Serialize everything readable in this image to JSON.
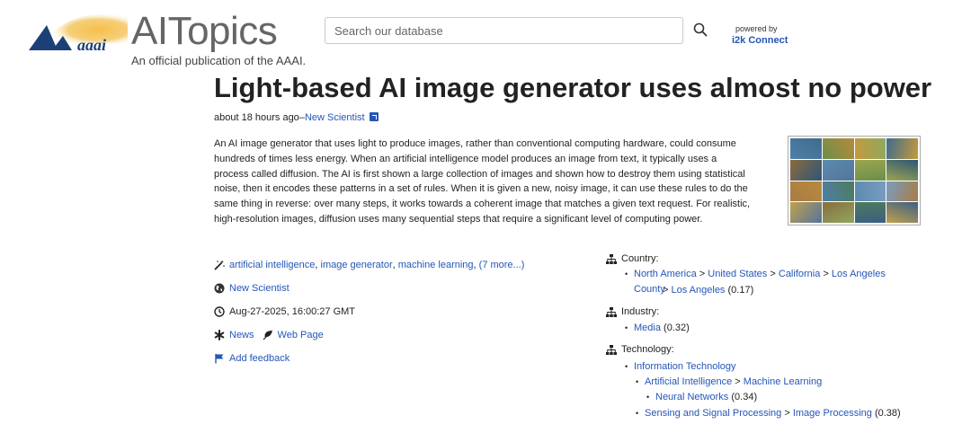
{
  "header": {
    "logo_text": "aaai",
    "brand": "AITopics",
    "tagline": "An official publication of the AAAI.",
    "search_placeholder": "Search our database",
    "powered_by": "powered by",
    "powered_brand_i2k": "i2k",
    "powered_brand_connect": " Connect"
  },
  "article": {
    "title": "Light-based AI image generator uses almost no power",
    "time_ago": "about 18 hours ago",
    "dash": "–",
    "source_link": "New Scientist",
    "summary": "An AI image generator that uses light to produce images, rather than conventional computing hardware, could consume hundreds of times less energy. When an artificial intelligence model produces an image from text, it typically uses a process called diffusion. The AI is first shown a large collection of images and shown how to destroy them using statistical noise, then it encodes these patterns in a set of rules. When it is given a new, noisy image, it can use these rules to do the same thing in reverse: over many steps, it works towards a coherent image that matches a given text request. For realistic, high-resolution images, diffusion uses many sequential steps that require a significant level of computing power."
  },
  "info": {
    "tags": [
      "artificial intelligence",
      "image generator",
      "machine learning"
    ],
    "tags_more": "(7 more...)",
    "tag_sep": ",",
    "source": "New Scientist",
    "date": "Aug-27-2025, 16:00:27 GMT",
    "type_news": "News",
    "type_web": "Web Page",
    "feedback": "Add feedback"
  },
  "taxonomy": {
    "country_label": "Country:",
    "country": {
      "north_america": "North America",
      "united_states": "United States",
      "california": "California",
      "los_angeles_county": "Los Angeles County",
      "los_angeles": "Los Angeles",
      "score": "(0.17)"
    },
    "industry_label": "Industry:",
    "industry": {
      "media": "Media",
      "score": "(0.32)"
    },
    "technology_label": "Technology:",
    "technology": {
      "information_technology": "Information Technology",
      "artificial_intelligence": "Artificial Intelligence",
      "machine_learning": "Machine Learning",
      "neural_networks": "Neural Networks",
      "neural_score": "(0.34)",
      "sensing": "Sensing and Signal Processing",
      "image_processing": "Image Processing",
      "image_score": "(0.38)"
    },
    "gt": ">"
  },
  "colors": {
    "link": "#2456b8",
    "logo_navy": "#1c3f78",
    "logo_gold": "#f2b13a"
  },
  "icons": {
    "search": "search-icon",
    "magic_wand": "magic-wand-icon",
    "globe": "globe-icon",
    "clock": "clock-icon",
    "news": "asterisk-icon",
    "web_page": "leaf-icon",
    "feedback": "flag-icon",
    "taxonomy": "sitemap-icon",
    "external": "external-link-icon"
  }
}
